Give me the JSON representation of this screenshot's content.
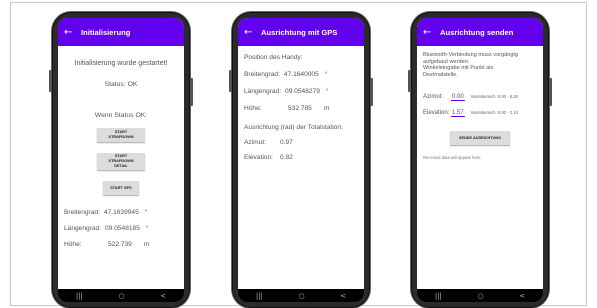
{
  "phone1": {
    "title": "Initialisierung",
    "message": "Initialisierung wurde gestartet!",
    "status": "Status:  OK",
    "if_status": "Wenn Status OK:",
    "btn_start_strapdown": "START STRAPDOWN",
    "btn_start_strapdown_detail_line1": "START STRAPDOWN",
    "btn_start_strapdown_detail_line2": "DETAIL",
    "btn_start_gps": "START GPS",
    "lat_label": "Breitengrad:",
    "lat_value": "47.1639945",
    "lat_unit": "°",
    "lon_label": "Längengrad:",
    "lon_value": "09.0548185",
    "lon_unit": "°",
    "height_label": "Höhe:",
    "height_value": "522.739",
    "height_unit": "m"
  },
  "phone2": {
    "title": "Ausrichtung mit GPS",
    "position_header": "Position des Handy:",
    "lat_label": "Breitengrad:",
    "lat_value": "47.1640005",
    "lat_unit": "°",
    "lon_label": "Längengrad:",
    "lon_value": "09.0548279",
    "lon_unit": "°",
    "height_label": "Höhe:",
    "height_value": "532.785",
    "height_unit": "m",
    "orientation_header": "Ausrichtung (rad) der Totalstation:",
    "azimuth_label": "Azimut:",
    "azimuth_value": "0.97",
    "elevation_label": "Elevation:",
    "elevation_value": "0.82"
  },
  "phone3": {
    "title": "Ausrichtung senden",
    "info_line1": "Bluetooth-Verbindung muss vorgängig",
    "info_line2": "aufgebaut werden.",
    "info_line3": "Winkeleingabe mit Punkt als",
    "info_line4": "Dezimalstelle.",
    "azimuth_label": "Azimut:",
    "azimuth_value": "0.00",
    "azimuth_range": "Wertebereich: 0.00 - 6.28",
    "elevation_label": "Elevation:",
    "elevation_value": "1.57",
    "elevation_range": "Wertebereich: 0.00 - 3.14",
    "send_button": "SENDE AUSRICHTUNG",
    "received_text": "Received data will appear here."
  },
  "nav": {
    "recent": "|||",
    "home": "○",
    "back": "<"
  },
  "icons": {
    "back": "←"
  },
  "colors": {
    "appbar": "#6200ee",
    "phone_body": "#2b2b2e",
    "navbar": "#000000"
  }
}
